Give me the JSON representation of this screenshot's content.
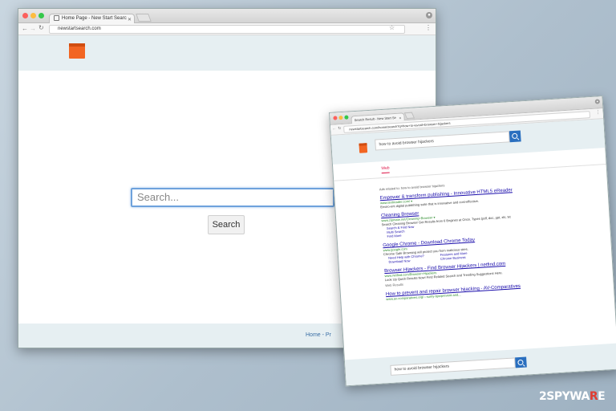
{
  "window1": {
    "tab_title": "Home Page - New Start Searc",
    "address": "newstartsearch.com",
    "search_placeholder": "Search...",
    "search_button": "Search",
    "footer_link": "Home - Pr"
  },
  "window2": {
    "tab_title": "Search Result - New Start Se",
    "address": "newstartsearch.com/home/search?q=how+to+avoid+browser+hijackers",
    "search_value": "how to avoid browser hijackers",
    "tab_web": "Web",
    "related": "Ads related to: how to avoid browser hijackers",
    "results": [
      {
        "title": "Empower & transform publishing - Innovative HTML5 eReader",
        "url": "www.textreader.com/ ▾",
        "desc": "Enviro-ent digital publishing suite that is innovative and cost-effective."
      },
      {
        "title": "Cleaning Browser",
        "url": "www.zipmate.net/Cleaning+Browser ▾",
        "desc": "Search Cleaning Browser Get Results from 6 Engines at Once. Types (pdf, doc, ppt, xls, txt"
      },
      {
        "title": "Google Chrome - Download Chrome Today",
        "url": "www.google.com",
        "desc": "Chrome Safe Browsing will protect you from malicious sites."
      },
      {
        "title": "Browser Hijackers - Find Browser Hijackers | netfind.com",
        "url": "www.netfind.com/Browser+Hijackers",
        "desc": "Look Up Quick Results Now! Find Related Search and Trending Suggestions Here."
      },
      {
        "title": "How to prevent and repair browser hijacking - AV-Comparatives",
        "url": "www.av-comparatives.org/ › surity-tips/prevent-and...",
        "desc": ""
      }
    ],
    "sublinks2": [
      "Search & Find Now",
      "Multi Search",
      "Find More"
    ],
    "sublinks3a": [
      "Need Help with Chrome?",
      "Download Now"
    ],
    "sublinks3b": [
      "Features and More",
      "Chrome Business"
    ],
    "web_results": "Web Results",
    "footer_search": "how to avoid browser hijackers"
  },
  "watermark": {
    "a": "2SPYWA",
    "b": "R",
    "c": "E"
  }
}
